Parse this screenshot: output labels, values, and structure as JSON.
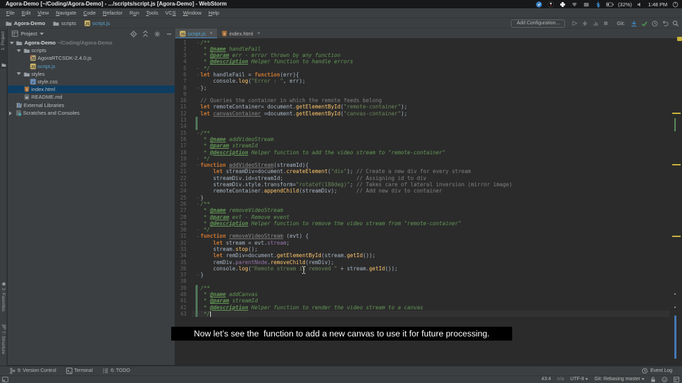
{
  "window": {
    "title": "Agora-Demo [~/Coding/Agora-Demo] - .../scripts/script.js [Agora-Demo] - WebStorm"
  },
  "tray": {
    "battery": "(32%)",
    "time": "1:48 PM"
  },
  "menubar": {
    "items": [
      {
        "label": "File",
        "mnemonic": 0
      },
      {
        "label": "Edit",
        "mnemonic": 0
      },
      {
        "label": "View",
        "mnemonic": 0
      },
      {
        "label": "Navigate",
        "mnemonic": 0
      },
      {
        "label": "Code",
        "mnemonic": 0
      },
      {
        "label": "Refactor",
        "mnemonic": 0
      },
      {
        "label": "Run",
        "mnemonic": 1
      },
      {
        "label": "Tools",
        "mnemonic": 0
      },
      {
        "label": "VCS",
        "mnemonic": 2
      },
      {
        "label": "Window",
        "mnemonic": 0
      },
      {
        "label": "Help",
        "mnemonic": 0
      }
    ]
  },
  "navbar": {
    "crumbs": [
      {
        "label": "Agora-Demo",
        "icon": "folder",
        "bold": true
      },
      {
        "label": "scripts",
        "icon": "folder",
        "bold": false
      },
      {
        "label": "script.js",
        "icon": "js",
        "bold": false,
        "modified": true
      }
    ]
  },
  "toolbar": {
    "add_configuration_label": "Add Configuration...",
    "git_label": "Git:"
  },
  "left_stripe": {
    "top_item": "1: Project",
    "bottom_items": [
      "2: Favorites",
      "7: Structure"
    ]
  },
  "project_panel": {
    "title": "Project",
    "tree": [
      {
        "level": "root",
        "arrow": "down",
        "icon": "folder",
        "label": "Agora-Demo",
        "suffix": " ~/Coding/Agora-Demo",
        "bold": true
      },
      {
        "level": "l1",
        "arrow": "down",
        "icon": "folder",
        "label": "scripts"
      },
      {
        "level": "l2",
        "arrow": null,
        "icon": "jslib",
        "label": "AgoraRTCSDK-2.4.0.js"
      },
      {
        "level": "l2",
        "arrow": null,
        "icon": "js",
        "label": "script.js",
        "modified": true
      },
      {
        "level": "l1",
        "arrow": "down",
        "icon": "folder",
        "label": "styles"
      },
      {
        "level": "l2",
        "arrow": null,
        "icon": "css",
        "label": "style.css"
      },
      {
        "level": "l1f",
        "arrow": null,
        "icon": "html",
        "label": "index.html",
        "selected": true
      },
      {
        "level": "l1f",
        "arrow": null,
        "icon": "md",
        "label": "README.md"
      },
      {
        "level": "root2",
        "arrow": null,
        "icon": "extlib",
        "label": "External Libraries"
      },
      {
        "level": "root3",
        "arrow": "right",
        "icon": "scratch",
        "label": "Scratches and Consoles"
      }
    ]
  },
  "tabs": [
    {
      "label": "script.js",
      "icon": "js",
      "active": true,
      "modified": true,
      "close": "×"
    },
    {
      "label": "index.html",
      "icon": "html",
      "active": false,
      "modified": false,
      "close": "×"
    }
  ],
  "editor": {
    "lines": [
      [
        [
          "c",
          "/**"
        ]
      ],
      [
        [
          "c",
          " * "
        ],
        [
          "t",
          "@name"
        ],
        [
          "c",
          " handleFail"
        ]
      ],
      [
        [
          "c",
          " * "
        ],
        [
          "t",
          "@param"
        ],
        [
          "c",
          " err - error thrown by any function"
        ]
      ],
      [
        [
          "c",
          " * "
        ],
        [
          "t",
          "@description"
        ],
        [
          "c",
          " Helper function to handle errors"
        ]
      ],
      [
        [
          "c",
          " */"
        ]
      ],
      [
        [
          "k",
          "let"
        ],
        [
          "d",
          " handleFail = "
        ],
        [
          "k",
          "function"
        ],
        [
          "d",
          "(err){"
        ]
      ],
      [
        [
          "d",
          "    console."
        ],
        [
          "f",
          "log"
        ],
        [
          "d",
          "("
        ],
        [
          "s",
          "\"Error : \""
        ],
        [
          "d",
          ", err);"
        ]
      ],
      [
        [
          "d",
          "};"
        ]
      ],
      [],
      [
        [
          "lc",
          "// Queries the container in which the remote feeds belong"
        ]
      ],
      [
        [
          "k",
          "let"
        ],
        [
          "d",
          " remoteContainer= document."
        ],
        [
          "f",
          "getElementById"
        ],
        [
          "d",
          "("
        ],
        [
          "s",
          "\"remote-container\""
        ],
        [
          "d",
          ");"
        ]
      ],
      [
        [
          "k",
          "let"
        ],
        [
          "d",
          " "
        ],
        [
          "u",
          "canvasContainer"
        ],
        [
          "d",
          " =document."
        ],
        [
          "f",
          "getElementById"
        ],
        [
          "d",
          "("
        ],
        [
          "s",
          "\"canvas-container\""
        ],
        [
          "d",
          ");"
        ]
      ],
      [],
      [],
      [
        [
          "c",
          "/**"
        ]
      ],
      [
        [
          "c",
          " * "
        ],
        [
          "t",
          "@name"
        ],
        [
          "c",
          " addVideoStream"
        ]
      ],
      [
        [
          "c",
          " * "
        ],
        [
          "t",
          "@param"
        ],
        [
          "c",
          " streamId"
        ]
      ],
      [
        [
          "c",
          " * "
        ],
        [
          "t",
          "@description"
        ],
        [
          "c",
          " Helper function to add the video stream to \"remote-container\""
        ]
      ],
      [
        [
          "c",
          " */"
        ]
      ],
      [
        [
          "k",
          "function"
        ],
        [
          "d",
          " "
        ],
        [
          "u",
          "addVideoStream"
        ],
        [
          "d",
          "(streamId){"
        ]
      ],
      [
        [
          "d",
          "    "
        ],
        [
          "k",
          "let"
        ],
        [
          "d",
          " streamDiv=document."
        ],
        [
          "f",
          "createElement"
        ],
        [
          "d",
          "("
        ],
        [
          "s",
          "\"div\""
        ],
        [
          "d",
          "); "
        ],
        [
          "lc",
          "// Create a new div for every stream"
        ]
      ],
      [
        [
          "d",
          "    streamDiv.id=streamId;                       "
        ],
        [
          "lc",
          "// Assigning id to div"
        ]
      ],
      [
        [
          "d",
          "    streamDiv.style.transform="
        ],
        [
          "s",
          "\"rotateY(180deg)\""
        ],
        [
          "d",
          "; "
        ],
        [
          "lc",
          "// Takes care of lateral inversion (mirror image)"
        ]
      ],
      [
        [
          "d",
          "    remoteContainer."
        ],
        [
          "f",
          "appendChild"
        ],
        [
          "d",
          "(streamDiv);      "
        ],
        [
          "lc",
          "// Add new div to container"
        ]
      ],
      [
        [
          "d",
          "}"
        ]
      ],
      [
        [
          "c",
          "/**"
        ]
      ],
      [
        [
          "c",
          " * "
        ],
        [
          "t",
          "@name"
        ],
        [
          "c",
          " removeVideoStream"
        ]
      ],
      [
        [
          "c",
          " * "
        ],
        [
          "t",
          "@param"
        ],
        [
          "c",
          " evt - Remove event"
        ]
      ],
      [
        [
          "c",
          " * "
        ],
        [
          "t",
          "@description"
        ],
        [
          "c",
          " Helper function to remove the video stream from \"remote-container\""
        ]
      ],
      [
        [
          "c",
          " */"
        ]
      ],
      [
        [
          "k",
          "function"
        ],
        [
          "d",
          " "
        ],
        [
          "u",
          "removeVideoStream"
        ],
        [
          "d",
          " (evt) {"
        ]
      ],
      [
        [
          "d",
          "    "
        ],
        [
          "k",
          "let"
        ],
        [
          "d",
          " stream = evt."
        ],
        [
          "p",
          "stream"
        ],
        [
          "d",
          ";"
        ]
      ],
      [
        [
          "d",
          "    stream."
        ],
        [
          "f",
          "stop"
        ],
        [
          "d",
          "();"
        ]
      ],
      [
        [
          "d",
          "    "
        ],
        [
          "k",
          "let"
        ],
        [
          "d",
          " remDiv=document."
        ],
        [
          "f",
          "getElementById"
        ],
        [
          "d",
          "(stream."
        ],
        [
          "f",
          "getId"
        ],
        [
          "d",
          "());"
        ]
      ],
      [
        [
          "d",
          "    remDiv."
        ],
        [
          "p",
          "parentNode"
        ],
        [
          "d",
          "."
        ],
        [
          "f",
          "removeChild"
        ],
        [
          "d",
          "(remDiv);"
        ]
      ],
      [
        [
          "d",
          "    console."
        ],
        [
          "f",
          "log"
        ],
        [
          "d",
          "("
        ],
        [
          "s",
          "\"Remote stream is removed \""
        ],
        [
          "d",
          " + stream."
        ],
        [
          "f",
          "getId"
        ],
        [
          "d",
          "());"
        ]
      ],
      [
        [
          "d",
          "}"
        ]
      ],
      [],
      [
        [
          "c",
          "/**"
        ]
      ],
      [
        [
          "c",
          " * "
        ],
        [
          "t",
          "@name"
        ],
        [
          "c",
          " addCanvas"
        ]
      ],
      [
        [
          "c",
          " * "
        ],
        [
          "t",
          "@param"
        ],
        [
          "c",
          " streamId"
        ]
      ],
      [
        [
          "c",
          " * "
        ],
        [
          "t",
          "@description"
        ],
        [
          "c",
          " Helper function to render the video stream to a canvas"
        ]
      ],
      [
        [
          "c",
          " */"
        ]
      ]
    ],
    "caret": {
      "line": 43,
      "col": 4
    },
    "vcs_added_ranges": [
      [
        13,
        14
      ],
      [
        39,
        43
      ]
    ],
    "fold_marker_lines": [
      1,
      5,
      6,
      8,
      15,
      19,
      20,
      25,
      26,
      30,
      31,
      37,
      39,
      43
    ],
    "error_stripe": {
      "indicator": "warnings",
      "warning_lines": [
        12,
        20,
        31
      ],
      "added_range": [
        13,
        14
      ],
      "dot_lines": [
        40,
        42
      ]
    }
  },
  "caption": {
    "text": "Now let’s see the  function to add a new canvas to use it for future processing."
  },
  "bottom_bar": {
    "items": [
      {
        "label": "9: Version Control",
        "icon": "branch"
      },
      {
        "label": "Terminal",
        "icon": "terminal"
      },
      {
        "label": "6: TODO",
        "icon": "todo"
      }
    ],
    "event_log_label": "Event Log"
  },
  "status_bar": {
    "caret_position": "43:4",
    "line_separator": "n/a",
    "encoding": "UTF-8",
    "vcs_branch": "Git: Rebasing master"
  }
}
